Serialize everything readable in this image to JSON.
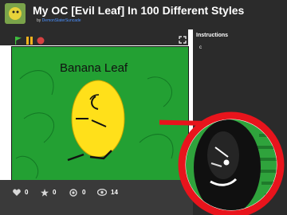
{
  "header": {
    "title": "My OC [Evil Leaf] In 100 Different Styles",
    "by_label": "by",
    "author": "DemonSlaterSuncade"
  },
  "stage": {
    "text": "Banana Leaf"
  },
  "stats": {
    "loves": "0",
    "favorites": "0",
    "remixes": "0",
    "views": "14"
  },
  "sidebar": {
    "heading": "Instructions",
    "snippet": "c"
  },
  "colors": {
    "header_bg": "#2b2b2b",
    "stage_green": "#23a033",
    "callout_red": "#e8141c",
    "flag_green": "#3fbf3f",
    "stop_red": "#d64141",
    "pause_orange": "#f2b21e"
  }
}
